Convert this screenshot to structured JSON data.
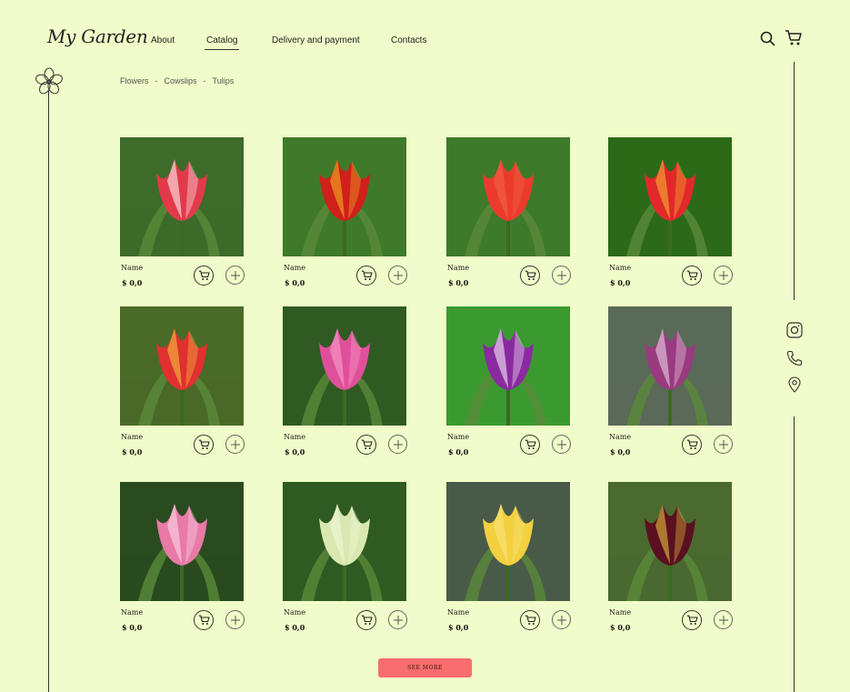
{
  "header": {
    "logo": "My Garden",
    "nav": [
      {
        "label": "About",
        "active": false
      },
      {
        "label": "Catalog",
        "active": true
      },
      {
        "label": "Delivery and payment",
        "active": false
      },
      {
        "label": "Contacts",
        "active": false
      }
    ],
    "icons": {
      "search": "search-icon",
      "cart": "cart-icon"
    }
  },
  "breadcrumb": [
    "Flowers",
    "Cowslips",
    "Tulips"
  ],
  "breadcrumb_separator": "-",
  "products": [
    {
      "name": "Name",
      "price": "$ 0,0",
      "colors": [
        "#e23a4a",
        "#ffffff",
        "#3c6b2a"
      ]
    },
    {
      "name": "Name",
      "price": "$ 0,0",
      "colors": [
        "#d0201a",
        "#f0c020",
        "#3f7a2a"
      ]
    },
    {
      "name": "Name",
      "price": "$ 0,0",
      "colors": [
        "#ec3b2c",
        "#f06a4a",
        "#3d7a2a"
      ]
    },
    {
      "name": "Name",
      "price": "$ 0,0",
      "colors": [
        "#e2282a",
        "#f5c030",
        "#2c6a18"
      ]
    },
    {
      "name": "Name",
      "price": "$ 0,0",
      "colors": [
        "#e03030",
        "#f4d040",
        "#4a6a28"
      ]
    },
    {
      "name": "Name",
      "price": "$ 0,0",
      "colors": [
        "#e0509a",
        "#f8a8d0",
        "#2f5a22"
      ]
    },
    {
      "name": "Name",
      "price": "$ 0,0",
      "colors": [
        "#8a2aa0",
        "#ffffff",
        "#3a9a30"
      ]
    },
    {
      "name": "Name",
      "price": "$ 0,0",
      "colors": [
        "#9a3a80",
        "#f0e0ea",
        "#5a6a58"
      ]
    },
    {
      "name": "Name",
      "price": "$ 0,0",
      "colors": [
        "#e87aa6",
        "#fbe0ec",
        "#2a4a20"
      ]
    },
    {
      "name": "Name",
      "price": "$ 0,0",
      "colors": [
        "#d8e8b0",
        "#f6fae0",
        "#2f5a22"
      ]
    },
    {
      "name": "Name",
      "price": "$ 0,0",
      "colors": [
        "#f2d040",
        "#f8e680",
        "#4a5a48"
      ]
    },
    {
      "name": "Name",
      "price": "$ 0,0",
      "colors": [
        "#5a1020",
        "#f0d040",
        "#4a6a30"
      ]
    }
  ],
  "see_more_label": "SEE MORE",
  "social": [
    "instagram-icon",
    "phone-icon",
    "location-icon"
  ]
}
